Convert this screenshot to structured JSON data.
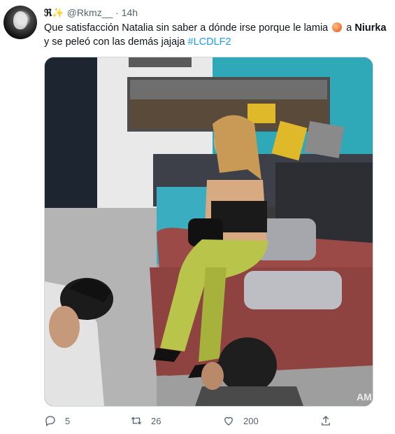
{
  "tweet": {
    "display_name": "ℜ✨",
    "handle": "@Rkmz__",
    "separator": "·",
    "time": "14h",
    "text_line1_a": "Que satisfacción Natalia sin saber a dónde irse porque le lamia",
    "text_line1_b": "a",
    "mention": "Niurka",
    "text_line2": "y se peleó con las demás jajaja",
    "hashtag": "#LCDLF2",
    "peach_icon": "peach-emoji-icon",
    "media_watermark": "AM"
  },
  "actions": {
    "reply_count": "5",
    "retweet_count": "26",
    "like_count": "200",
    "share_icon": "share-icon"
  },
  "colors": {
    "link": "#1d9bf0",
    "secondary_text": "#536471",
    "primary_text": "#0f1419"
  }
}
